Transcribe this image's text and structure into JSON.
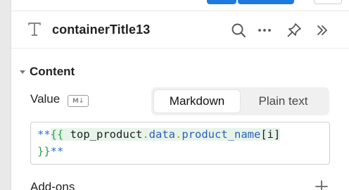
{
  "header": {
    "title": "containerTitle13",
    "icons": [
      "text-type-icon",
      "search-icon",
      "more-icon",
      "pin-icon",
      "expand-icon"
    ]
  },
  "content": {
    "section_title": "Content",
    "value_label": "Value",
    "markdown_badge": "M↓",
    "mode_tabs": [
      "Markdown",
      "Plain text"
    ],
    "selected_mode": "Markdown",
    "code": {
      "line1": {
        "md_open": "**",
        "brace_open": "{{",
        "var": " top_product",
        "dot1": ".",
        "prop1": "data",
        "dot2": ".",
        "prop2": "product_name",
        "index": "[i]"
      },
      "line2": {
        "brace_close": "}}",
        "md_close": "**"
      }
    }
  },
  "addons": {
    "label": "Add-ons"
  },
  "colors": {
    "accent": "#1f7ae0",
    "markdown_token": "#2f6fd6",
    "brace_token": "#2e9e4a",
    "property_token": "#2f5fb8",
    "dot_token": "#c48b2b"
  }
}
